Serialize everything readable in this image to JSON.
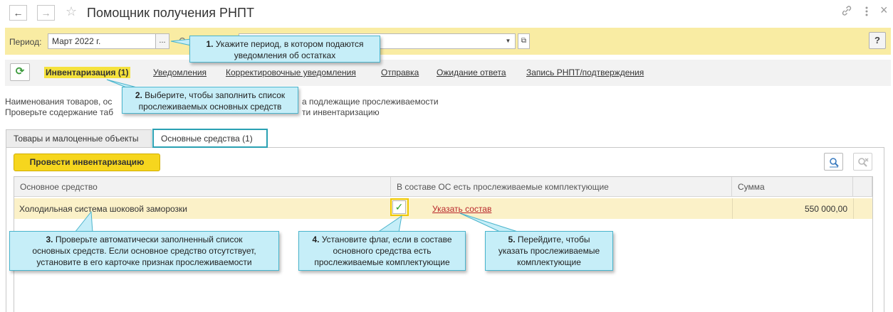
{
  "window": {
    "title": "Помощник получения РНПТ",
    "back_icon": "←",
    "forward_icon": "→",
    "star_icon": "☆"
  },
  "period": {
    "label": "Период:",
    "value": "Март 2022 г.",
    "select_button": "..."
  },
  "help_button": "?",
  "nav": {
    "links": [
      {
        "label": "Инвентаризация (1)"
      },
      {
        "label": "Уведомления"
      },
      {
        "label": "Корректировочные уведомления"
      },
      {
        "label": "Отправка"
      },
      {
        "label": "Ожидание ответа"
      },
      {
        "label": "Запись РНПТ/подтверждения"
      }
    ]
  },
  "description": {
    "line1_start": "Наименования товаров, ос",
    "line1_end": "а подлежащие прослеживаемости",
    "line2_start": "Проверьте содержание таб",
    "line2_end": "ти инвентаризацию"
  },
  "tabs": [
    {
      "label": "Товары и малоценные объекты"
    },
    {
      "label": "Основные средства (1)"
    }
  ],
  "toolbar": {
    "inventory_button": "Провести инвентаризацию"
  },
  "table": {
    "columns": [
      "Основное средство",
      "В составе ОС есть прослеживаемые комплектующие",
      "Сумма"
    ],
    "rows": [
      {
        "asset": "Холодильная система шоковой заморозки",
        "checked": true,
        "link": "Указать состав",
        "sum": "550 000,00"
      }
    ]
  },
  "callouts": {
    "c1": {
      "num": "1.",
      "line1": " Укажите период, в котором подаются",
      "line2": "уведомления об остатках"
    },
    "c2": {
      "num": "2.",
      "line1": " Выберите, чтобы заполнить список",
      "line2": "прослеживаемых основных средств"
    },
    "c3": {
      "num": "3.",
      "line1": " Проверьте автоматически заполненный список",
      "line2": "основных средств. Если основное средство отсутствует,",
      "line3": "установите в его карточке признак прослеживаемости"
    },
    "c4": {
      "num": "4.",
      "line1": " Установите флаг, если в составе",
      "line2": "основного средства есть",
      "line3": "прослеживаемые комплектующие"
    },
    "c5": {
      "num": "5.",
      "line1": " Перейдите, чтобы",
      "line2": "указать прослеживаемые",
      "line3": "комплектующие"
    }
  }
}
